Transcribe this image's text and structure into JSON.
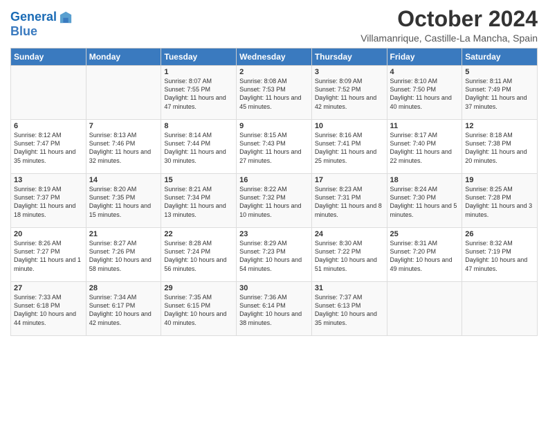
{
  "logo": {
    "line1": "General",
    "line2": "Blue"
  },
  "title": "October 2024",
  "subtitle": "Villamanrique, Castille-La Mancha, Spain",
  "weekdays": [
    "Sunday",
    "Monday",
    "Tuesday",
    "Wednesday",
    "Thursday",
    "Friday",
    "Saturday"
  ],
  "weeks": [
    [
      {
        "day": "",
        "sunrise": "",
        "sunset": "",
        "daylight": ""
      },
      {
        "day": "",
        "sunrise": "",
        "sunset": "",
        "daylight": ""
      },
      {
        "day": "1",
        "sunrise": "Sunrise: 8:07 AM",
        "sunset": "Sunset: 7:55 PM",
        "daylight": "Daylight: 11 hours and 47 minutes."
      },
      {
        "day": "2",
        "sunrise": "Sunrise: 8:08 AM",
        "sunset": "Sunset: 7:53 PM",
        "daylight": "Daylight: 11 hours and 45 minutes."
      },
      {
        "day": "3",
        "sunrise": "Sunrise: 8:09 AM",
        "sunset": "Sunset: 7:52 PM",
        "daylight": "Daylight: 11 hours and 42 minutes."
      },
      {
        "day": "4",
        "sunrise": "Sunrise: 8:10 AM",
        "sunset": "Sunset: 7:50 PM",
        "daylight": "Daylight: 11 hours and 40 minutes."
      },
      {
        "day": "5",
        "sunrise": "Sunrise: 8:11 AM",
        "sunset": "Sunset: 7:49 PM",
        "daylight": "Daylight: 11 hours and 37 minutes."
      }
    ],
    [
      {
        "day": "6",
        "sunrise": "Sunrise: 8:12 AM",
        "sunset": "Sunset: 7:47 PM",
        "daylight": "Daylight: 11 hours and 35 minutes."
      },
      {
        "day": "7",
        "sunrise": "Sunrise: 8:13 AM",
        "sunset": "Sunset: 7:46 PM",
        "daylight": "Daylight: 11 hours and 32 minutes."
      },
      {
        "day": "8",
        "sunrise": "Sunrise: 8:14 AM",
        "sunset": "Sunset: 7:44 PM",
        "daylight": "Daylight: 11 hours and 30 minutes."
      },
      {
        "day": "9",
        "sunrise": "Sunrise: 8:15 AM",
        "sunset": "Sunset: 7:43 PM",
        "daylight": "Daylight: 11 hours and 27 minutes."
      },
      {
        "day": "10",
        "sunrise": "Sunrise: 8:16 AM",
        "sunset": "Sunset: 7:41 PM",
        "daylight": "Daylight: 11 hours and 25 minutes."
      },
      {
        "day": "11",
        "sunrise": "Sunrise: 8:17 AM",
        "sunset": "Sunset: 7:40 PM",
        "daylight": "Daylight: 11 hours and 22 minutes."
      },
      {
        "day": "12",
        "sunrise": "Sunrise: 8:18 AM",
        "sunset": "Sunset: 7:38 PM",
        "daylight": "Daylight: 11 hours and 20 minutes."
      }
    ],
    [
      {
        "day": "13",
        "sunrise": "Sunrise: 8:19 AM",
        "sunset": "Sunset: 7:37 PM",
        "daylight": "Daylight: 11 hours and 18 minutes."
      },
      {
        "day": "14",
        "sunrise": "Sunrise: 8:20 AM",
        "sunset": "Sunset: 7:35 PM",
        "daylight": "Daylight: 11 hours and 15 minutes."
      },
      {
        "day": "15",
        "sunrise": "Sunrise: 8:21 AM",
        "sunset": "Sunset: 7:34 PM",
        "daylight": "Daylight: 11 hours and 13 minutes."
      },
      {
        "day": "16",
        "sunrise": "Sunrise: 8:22 AM",
        "sunset": "Sunset: 7:32 PM",
        "daylight": "Daylight: 11 hours and 10 minutes."
      },
      {
        "day": "17",
        "sunrise": "Sunrise: 8:23 AM",
        "sunset": "Sunset: 7:31 PM",
        "daylight": "Daylight: 11 hours and 8 minutes."
      },
      {
        "day": "18",
        "sunrise": "Sunrise: 8:24 AM",
        "sunset": "Sunset: 7:30 PM",
        "daylight": "Daylight: 11 hours and 5 minutes."
      },
      {
        "day": "19",
        "sunrise": "Sunrise: 8:25 AM",
        "sunset": "Sunset: 7:28 PM",
        "daylight": "Daylight: 11 hours and 3 minutes."
      }
    ],
    [
      {
        "day": "20",
        "sunrise": "Sunrise: 8:26 AM",
        "sunset": "Sunset: 7:27 PM",
        "daylight": "Daylight: 11 hours and 1 minute."
      },
      {
        "day": "21",
        "sunrise": "Sunrise: 8:27 AM",
        "sunset": "Sunset: 7:26 PM",
        "daylight": "Daylight: 10 hours and 58 minutes."
      },
      {
        "day": "22",
        "sunrise": "Sunrise: 8:28 AM",
        "sunset": "Sunset: 7:24 PM",
        "daylight": "Daylight: 10 hours and 56 minutes."
      },
      {
        "day": "23",
        "sunrise": "Sunrise: 8:29 AM",
        "sunset": "Sunset: 7:23 PM",
        "daylight": "Daylight: 10 hours and 54 minutes."
      },
      {
        "day": "24",
        "sunrise": "Sunrise: 8:30 AM",
        "sunset": "Sunset: 7:22 PM",
        "daylight": "Daylight: 10 hours and 51 minutes."
      },
      {
        "day": "25",
        "sunrise": "Sunrise: 8:31 AM",
        "sunset": "Sunset: 7:20 PM",
        "daylight": "Daylight: 10 hours and 49 minutes."
      },
      {
        "day": "26",
        "sunrise": "Sunrise: 8:32 AM",
        "sunset": "Sunset: 7:19 PM",
        "daylight": "Daylight: 10 hours and 47 minutes."
      }
    ],
    [
      {
        "day": "27",
        "sunrise": "Sunrise: 7:33 AM",
        "sunset": "Sunset: 6:18 PM",
        "daylight": "Daylight: 10 hours and 44 minutes."
      },
      {
        "day": "28",
        "sunrise": "Sunrise: 7:34 AM",
        "sunset": "Sunset: 6:17 PM",
        "daylight": "Daylight: 10 hours and 42 minutes."
      },
      {
        "day": "29",
        "sunrise": "Sunrise: 7:35 AM",
        "sunset": "Sunset: 6:15 PM",
        "daylight": "Daylight: 10 hours and 40 minutes."
      },
      {
        "day": "30",
        "sunrise": "Sunrise: 7:36 AM",
        "sunset": "Sunset: 6:14 PM",
        "daylight": "Daylight: 10 hours and 38 minutes."
      },
      {
        "day": "31",
        "sunrise": "Sunrise: 7:37 AM",
        "sunset": "Sunset: 6:13 PM",
        "daylight": "Daylight: 10 hours and 35 minutes."
      },
      {
        "day": "",
        "sunrise": "",
        "sunset": "",
        "daylight": ""
      },
      {
        "day": "",
        "sunrise": "",
        "sunset": "",
        "daylight": ""
      }
    ]
  ]
}
